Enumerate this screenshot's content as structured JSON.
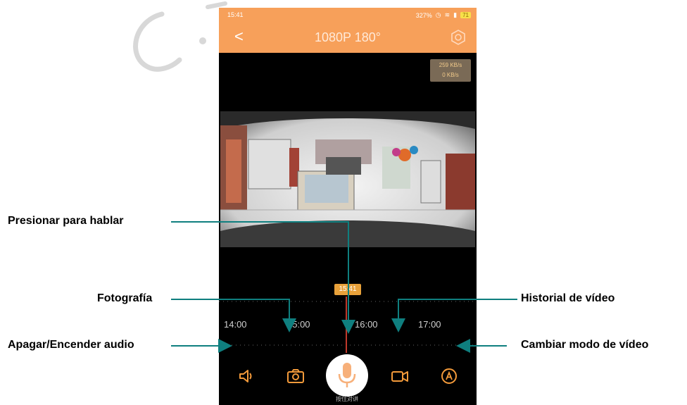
{
  "status_bar": {
    "time": "15:41",
    "right_text": "327%",
    "battery": "71"
  },
  "nav": {
    "back": "<",
    "title": "1080P 180°"
  },
  "speed_badge": {
    "line1": "259 KB/s",
    "line2": "0 KB/s"
  },
  "timeline": {
    "current_marker": "15:41",
    "labels": [
      "14:00",
      "15:00",
      "16:00",
      "17:00"
    ]
  },
  "bottom_bar": {
    "mic_label": "按住对讲"
  },
  "annotations": {
    "talk": "Presionar para hablar",
    "photo": "Fotografía",
    "audio": "Apagar/Encender audio",
    "history": "Historial de vídeo",
    "mode": "Cambiar modo de vídeo"
  },
  "colors": {
    "header": "#f7a05a",
    "accent": "#f39a3a",
    "annotation_line": "#0f7f7f",
    "timeline_marker": "#e8a13a"
  },
  "icons": [
    "back-icon",
    "settings-icon",
    "speaker-icon",
    "camera-icon",
    "microphone-icon",
    "video-record-icon",
    "mode-icon"
  ]
}
